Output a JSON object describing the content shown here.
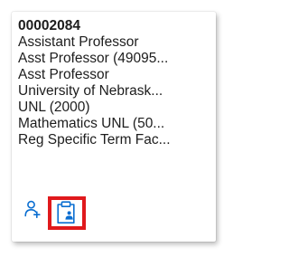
{
  "card": {
    "lines": [
      "00002084",
      "Assistant Professor",
      "Asst Professor (49095...",
      "Asst Professor",
      "University of Nebrask...",
      "UNL (2000)",
      "Mathematics UNL (50...",
      "Reg Specific Term Fac..."
    ]
  },
  "actions": [
    {
      "icon": "add-person-icon"
    },
    {
      "icon": "clipboard-person-icon",
      "highlighted": true
    }
  ],
  "colors": {
    "icon": "#0a6ed1",
    "highlight": "#e0191c",
    "text": "#1d1d1d"
  }
}
